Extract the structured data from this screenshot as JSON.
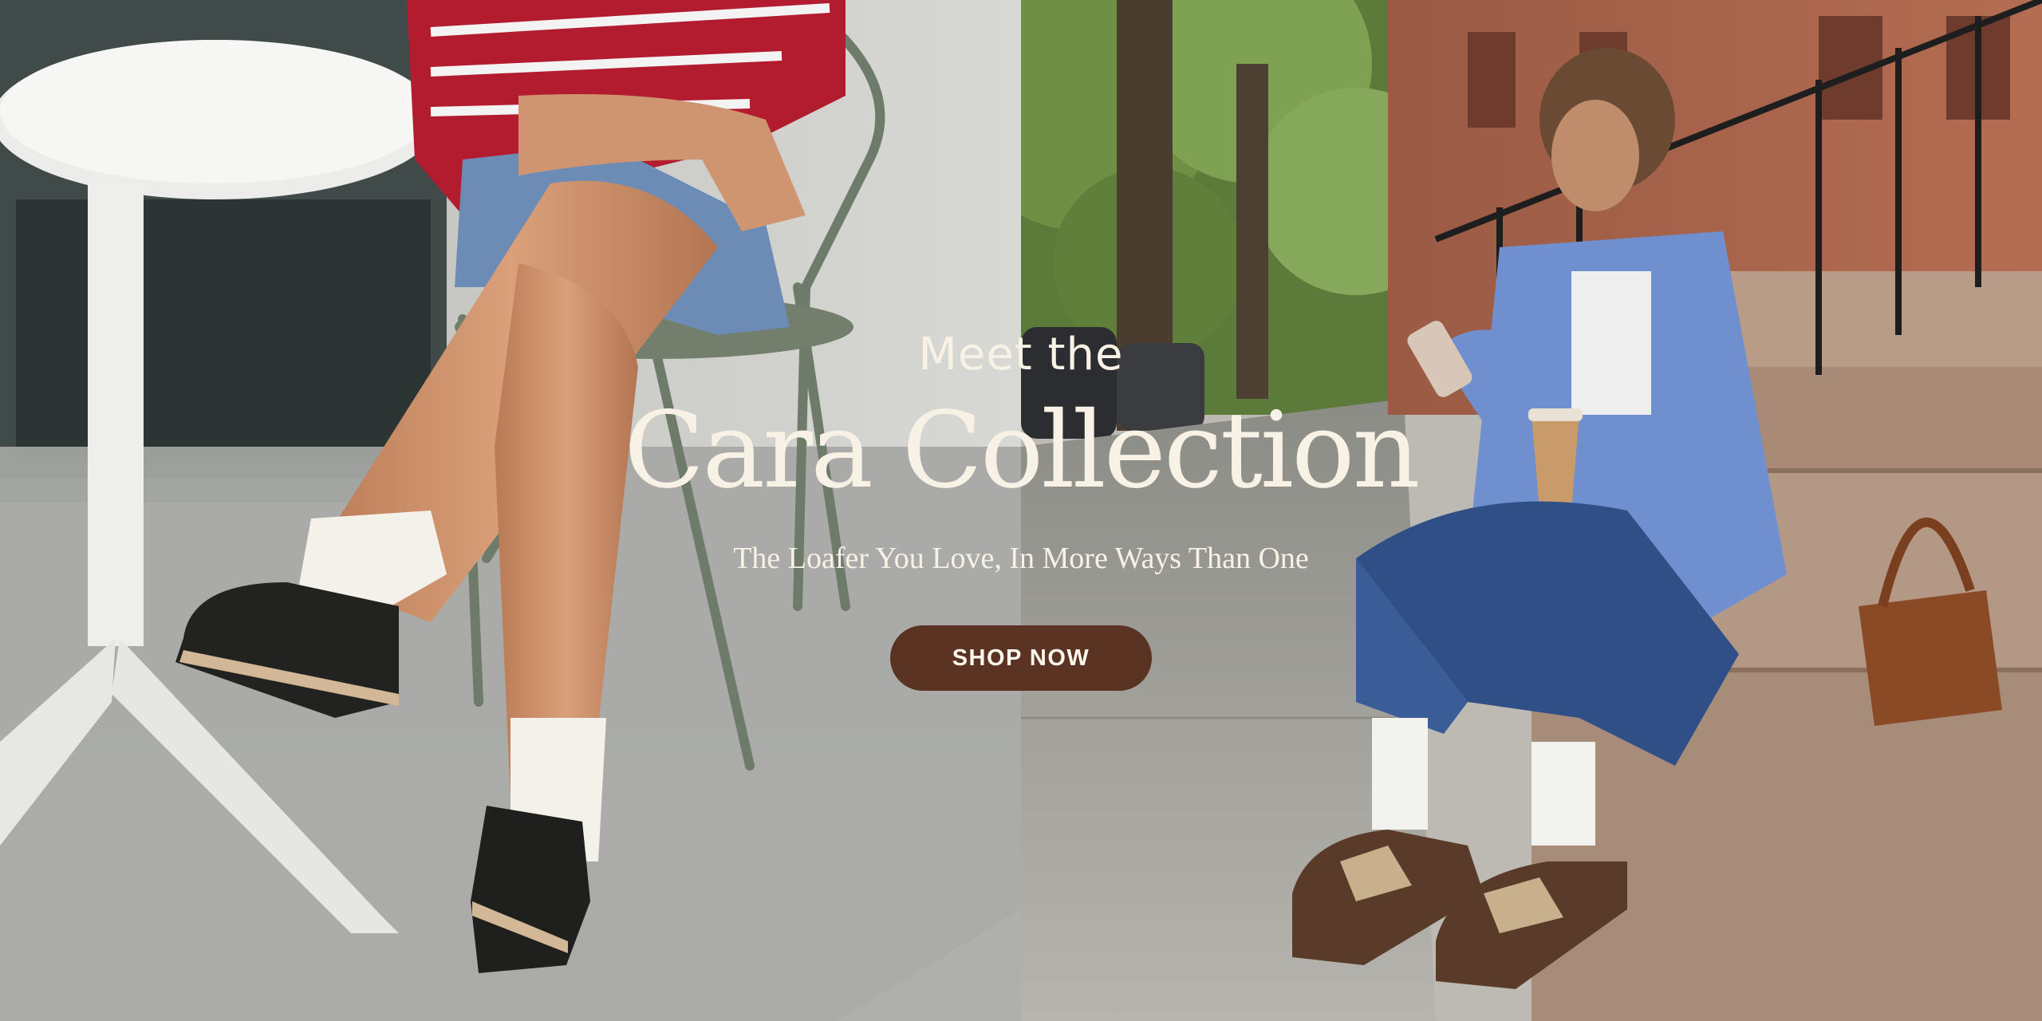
{
  "hero": {
    "eyebrow": "Meet the",
    "title": "Cara Collection",
    "subtitle": "The Loafer You Love, In More Ways Than One",
    "cta_label": "SHOP NOW"
  },
  "colors": {
    "text": "#f7f1e6",
    "button": "#5a3322",
    "button_text": "#fff8ef"
  },
  "images": {
    "left": "woman-seated-at-cafe-table-wearing-black-loafers",
    "right": "woman-sitting-on-stoop-with-coffee-and-brown-loafers"
  }
}
